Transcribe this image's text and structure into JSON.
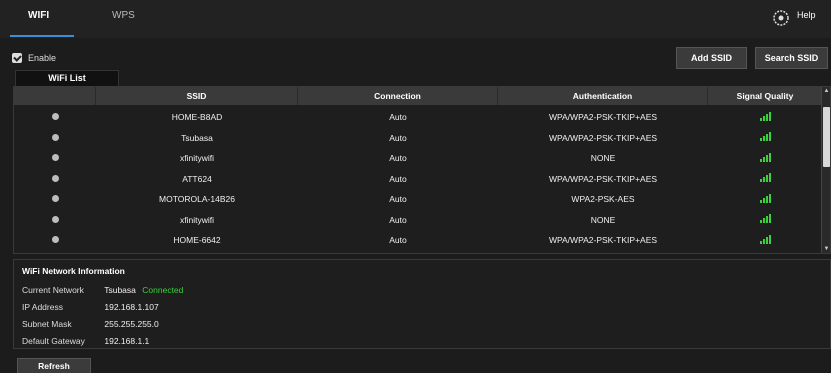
{
  "tabs": [
    {
      "label": "WIFI"
    },
    {
      "label": "WPS"
    }
  ],
  "help": {
    "label": "Help",
    "sub": "Options"
  },
  "enable": {
    "label": "Enable",
    "checked": true
  },
  "buttons": {
    "add_ssid": "Add SSID",
    "search_ssid": "Search SSID",
    "refresh": "Refresh"
  },
  "list_tab": "WiFi List",
  "table": {
    "headers": [
      "",
      "SSID",
      "Connection",
      "Authentication",
      "Signal Quality"
    ],
    "rows": [
      {
        "ssid": "HOME-B8AD",
        "connection": "Auto",
        "auth": "WPA/WPA2-PSK-TKIP+AES"
      },
      {
        "ssid": "Tsubasa",
        "connection": "Auto",
        "auth": "WPA/WPA2-PSK-TKIP+AES"
      },
      {
        "ssid": "xfinitywifi",
        "connection": "Auto",
        "auth": "NONE"
      },
      {
        "ssid": "ATT624",
        "connection": "Auto",
        "auth": "WPA/WPA2-PSK-TKIP+AES"
      },
      {
        "ssid": "MOTOROLA-14B26",
        "connection": "Auto",
        "auth": "WPA2-PSK-AES"
      },
      {
        "ssid": "xfinitywifi",
        "connection": "Auto",
        "auth": "NONE"
      },
      {
        "ssid": "HOME-6642",
        "connection": "Auto",
        "auth": "WPA/WPA2-PSK-TKIP+AES"
      }
    ]
  },
  "info": {
    "title": "WiFi Network Information",
    "current_network_label": "Current Network",
    "current_network": "Tsubasa",
    "status": "Connected",
    "ip_label": "IP Address",
    "ip": "192.168.1.107",
    "mask_label": "Subnet Mask",
    "mask": "255.255.255.0",
    "gateway_label": "Default Gateway",
    "gateway": "192.168.1.1"
  },
  "colors": {
    "accent": "#3c8fd6",
    "signal": "#3ad13a"
  }
}
